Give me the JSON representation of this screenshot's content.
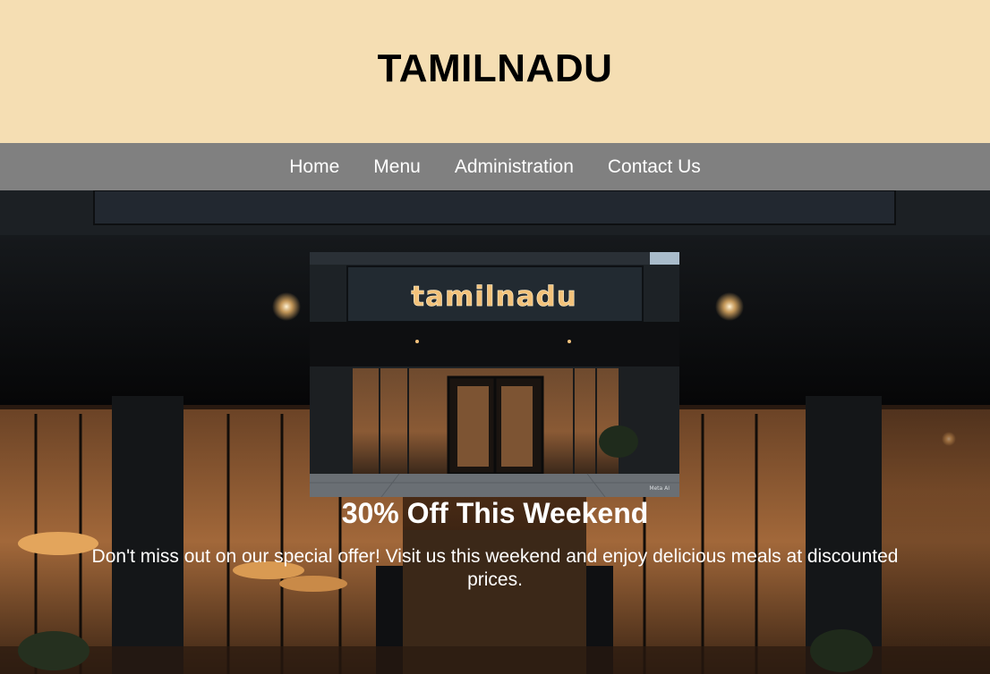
{
  "header": {
    "title": "TAMILNADU"
  },
  "nav": {
    "items": [
      {
        "label": "Home"
      },
      {
        "label": "Menu"
      },
      {
        "label": "Administration"
      },
      {
        "label": "Contact Us"
      }
    ]
  },
  "hero": {
    "promo_image": {
      "sign_text": "tamilnadu",
      "watermark": "Meta AI"
    },
    "offer_title": "30% Off This Weekend",
    "offer_description": "Don't miss out on our special offer! Visit us this weekend and enjoy delicious meals at discounted prices."
  },
  "colors": {
    "header_bg": "#f5deb3",
    "nav_bg": "#808080",
    "text_light": "#ffffff",
    "sign_glow": "#f3c27a"
  }
}
